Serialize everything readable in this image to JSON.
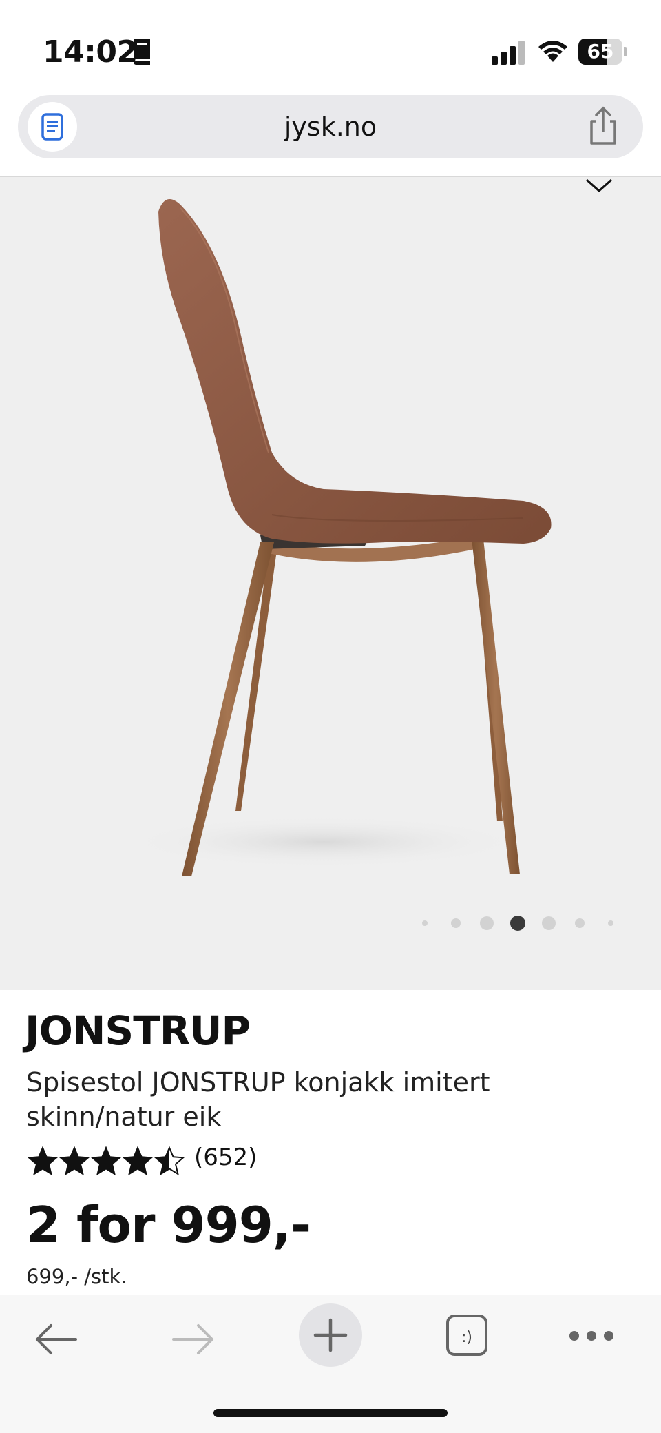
{
  "status_bar": {
    "time": "14:02",
    "battery_percent": "65",
    "battery_level": 0.65
  },
  "browser": {
    "url": "jysk.no"
  },
  "product": {
    "name": "JONSTRUP",
    "description": "Spisestol JONSTRUP konjakk imitert skinn/natur eik",
    "rating": 4.5,
    "rating_max": 5,
    "review_count": "(652)",
    "price": "2 for 999,-",
    "unit_price": "699,- /stk."
  },
  "gallery": {
    "image_count": 7,
    "active_index": 3
  },
  "colors": {
    "leather": "#8b5a43",
    "wood": "#9a6a45",
    "background": "#efefef"
  }
}
